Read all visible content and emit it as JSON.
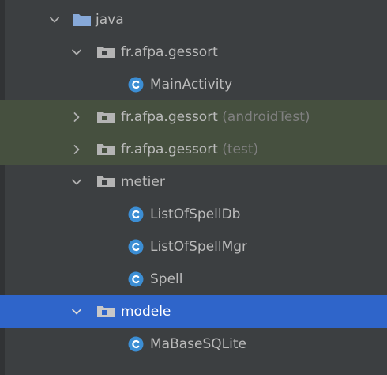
{
  "colors": {
    "background": "#3c3f41",
    "text": "#bbbbbb",
    "muted": "#808080",
    "selection": "#2f65ca",
    "test_row": "#46503f",
    "class_icon": "#3c8ed4",
    "folder": "#87a9d9",
    "package": "#b4b4b4"
  },
  "tree": {
    "nodes": [
      {
        "label": "java",
        "suffix": "",
        "icon": "source-folder-icon",
        "expanded": true,
        "chevron": "chevron-down-icon"
      },
      {
        "label": "fr.afpa.gessort",
        "suffix": "",
        "icon": "package-icon",
        "expanded": true,
        "chevron": "chevron-down-icon"
      },
      {
        "label": "MainActivity",
        "suffix": "",
        "icon": "class-icon",
        "expanded": false,
        "chevron": ""
      },
      {
        "label": "fr.afpa.gessort",
        "suffix": " (androidTest)",
        "icon": "package-icon",
        "expanded": false,
        "chevron": "chevron-right-icon"
      },
      {
        "label": "fr.afpa.gessort",
        "suffix": " (test)",
        "icon": "package-icon",
        "expanded": false,
        "chevron": "chevron-right-icon"
      },
      {
        "label": "metier",
        "suffix": "",
        "icon": "package-icon",
        "expanded": true,
        "chevron": "chevron-down-icon"
      },
      {
        "label": "ListOfSpellDb",
        "suffix": "",
        "icon": "class-icon",
        "expanded": false,
        "chevron": ""
      },
      {
        "label": "ListOfSpellMgr",
        "suffix": "",
        "icon": "class-icon",
        "expanded": false,
        "chevron": ""
      },
      {
        "label": "Spell",
        "suffix": "",
        "icon": "class-icon",
        "expanded": false,
        "chevron": ""
      },
      {
        "label": "modele",
        "suffix": "",
        "icon": "package-icon",
        "expanded": true,
        "chevron": "chevron-down-icon",
        "selected": true
      },
      {
        "label": "MaBaseSQLite",
        "suffix": "",
        "icon": "class-icon",
        "expanded": false,
        "chevron": ""
      }
    ]
  }
}
